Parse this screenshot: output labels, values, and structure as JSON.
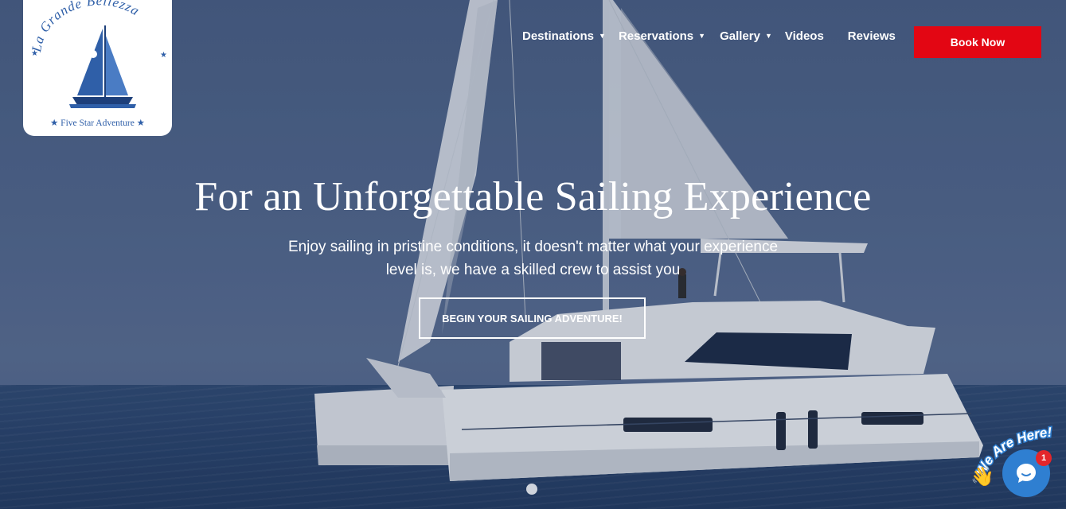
{
  "logo": {
    "name_words": [
      "La",
      "Grande",
      "Bellezza"
    ],
    "tagline": "Five Star Adventure"
  },
  "nav": {
    "items": [
      {
        "label": "Destinations",
        "has_dropdown": true
      },
      {
        "label": "Reservations",
        "has_dropdown": true
      },
      {
        "label": "Gallery",
        "has_dropdown": true
      },
      {
        "label": "Videos",
        "has_dropdown": false
      },
      {
        "label": "Reviews",
        "has_dropdown": false
      }
    ],
    "book_now": "Book Now"
  },
  "hero": {
    "headline": "For an Unforgettable Sailing Experience",
    "subtext": "Enjoy sailing in pristine conditions, it doesn't matter what your experience level is, we have a skilled crew to assist you",
    "cta": "BEGIN YOUR SAILING ADVENTURE!",
    "slide_count": 1
  },
  "chat": {
    "label": "We Are Here!",
    "badge": "1"
  },
  "colors": {
    "accent_red": "#e30613",
    "logo_blue": "#2f5fa8",
    "chat_blue": "#2f7fd1"
  }
}
